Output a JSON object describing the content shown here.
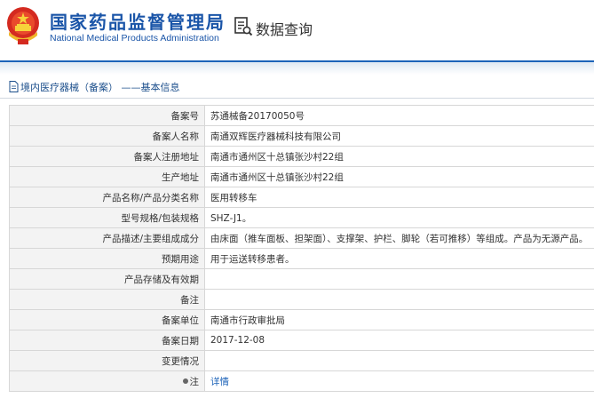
{
  "header": {
    "brand_cn": "国家药品监督管理局",
    "brand_en": "National Medical Products Administration",
    "query_label": "数据查询",
    "emblem_icon": "national-emblem-icon",
    "query_icon": "document-search-icon"
  },
  "section": {
    "title": "境内医疗器械（备案） ——基本信息",
    "icon": "document-icon"
  },
  "rows": [
    {
      "label": "备案号",
      "value": "苏通械备20170050号"
    },
    {
      "label": "备案人名称",
      "value": "南通双辉医疗器械科技有限公司"
    },
    {
      "label": "备案人注册地址",
      "value": "南通市通州区十总镇张沙村22组"
    },
    {
      "label": "生产地址",
      "value": "南通市通州区十总镇张沙村22组"
    },
    {
      "label": "产品名称/产品分类名称",
      "value": "医用转移车"
    },
    {
      "label": "型号规格/包装规格",
      "value": "SHZ-J1。"
    },
    {
      "label": "产品描述/主要组成成分",
      "value": "由床面（推车面板、担架面）、支撑架、护栏、脚轮（若可推移）等组成。产品为无源产品。"
    },
    {
      "label": "预期用途",
      "value": "用于运送转移患者。"
    },
    {
      "label": "产品存储及有效期",
      "value": ""
    },
    {
      "label": "备注",
      "value": ""
    },
    {
      "label": "备案单位",
      "value": "南通市行政审批局"
    },
    {
      "label": "备案日期",
      "value": "2017-12-08"
    },
    {
      "label": "变更情况",
      "value": ""
    },
    {
      "label": "注",
      "value": "详情"
    }
  ],
  "colors": {
    "brand": "#1a55a8",
    "rule": "#1c63b8",
    "link": "#1c63b8"
  }
}
